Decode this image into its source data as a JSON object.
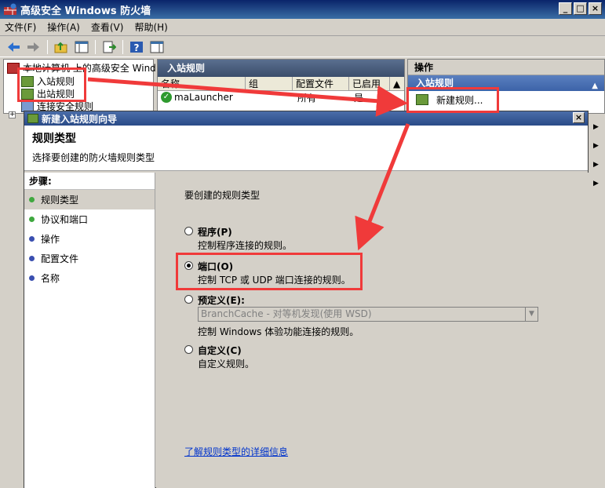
{
  "window": {
    "title": "高级安全 Windows 防火墙",
    "min": "_",
    "max": "□",
    "close": "×"
  },
  "menu": [
    "文件(F)",
    "操作(A)",
    "查看(V)",
    "帮助(H)"
  ],
  "tree": {
    "root": "本地计算机 上的高级安全 Wind",
    "items": [
      "入站规则",
      "出站规则",
      "连接安全规则"
    ]
  },
  "middle": {
    "title": "入站规则",
    "columns": [
      "名称",
      "组",
      "配置文件",
      "已启用"
    ],
    "rows": [
      {
        "name": "maLauncher",
        "group": "",
        "profile": "所有",
        "enabled": "是"
      }
    ]
  },
  "actions": {
    "title": "操作",
    "section": "入站规则",
    "new_rule": "新建规则..."
  },
  "dialog": {
    "title": "新建入站规则向导",
    "heading": "规则类型",
    "subheading": "选择要创建的防火墙规则类型",
    "close": "×",
    "steps_header": "步骤:",
    "steps": [
      {
        "label": "规则类型",
        "color": "#3fa83f"
      },
      {
        "label": "协议和端口",
        "color": "#3fa83f"
      },
      {
        "label": "操作",
        "color": "#3a4fb0"
      },
      {
        "label": "配置文件",
        "color": "#3a4fb0"
      },
      {
        "label": "名称",
        "color": "#3a4fb0"
      }
    ],
    "prompt": "要创建的规则类型",
    "options": [
      {
        "label": "程序(P)",
        "desc": "控制程序连接的规则。",
        "selected": false
      },
      {
        "label": "端口(O)",
        "desc": "控制 TCP 或 UDP 端口连接的规则。",
        "selected": true
      },
      {
        "label": "预定义(E):",
        "desc": "控制 Windows 体验功能连接的规则。",
        "selected": false
      },
      {
        "label": "自定义(C)",
        "desc": "自定义规则。",
        "selected": false
      }
    ],
    "predefined_select": "BranchCache - 对等机发现(使用 WSD)",
    "learn_more": "了解规则类型的详细信息"
  },
  "colors": {
    "annotation": "#f03a3a",
    "link": "#0033cc"
  }
}
